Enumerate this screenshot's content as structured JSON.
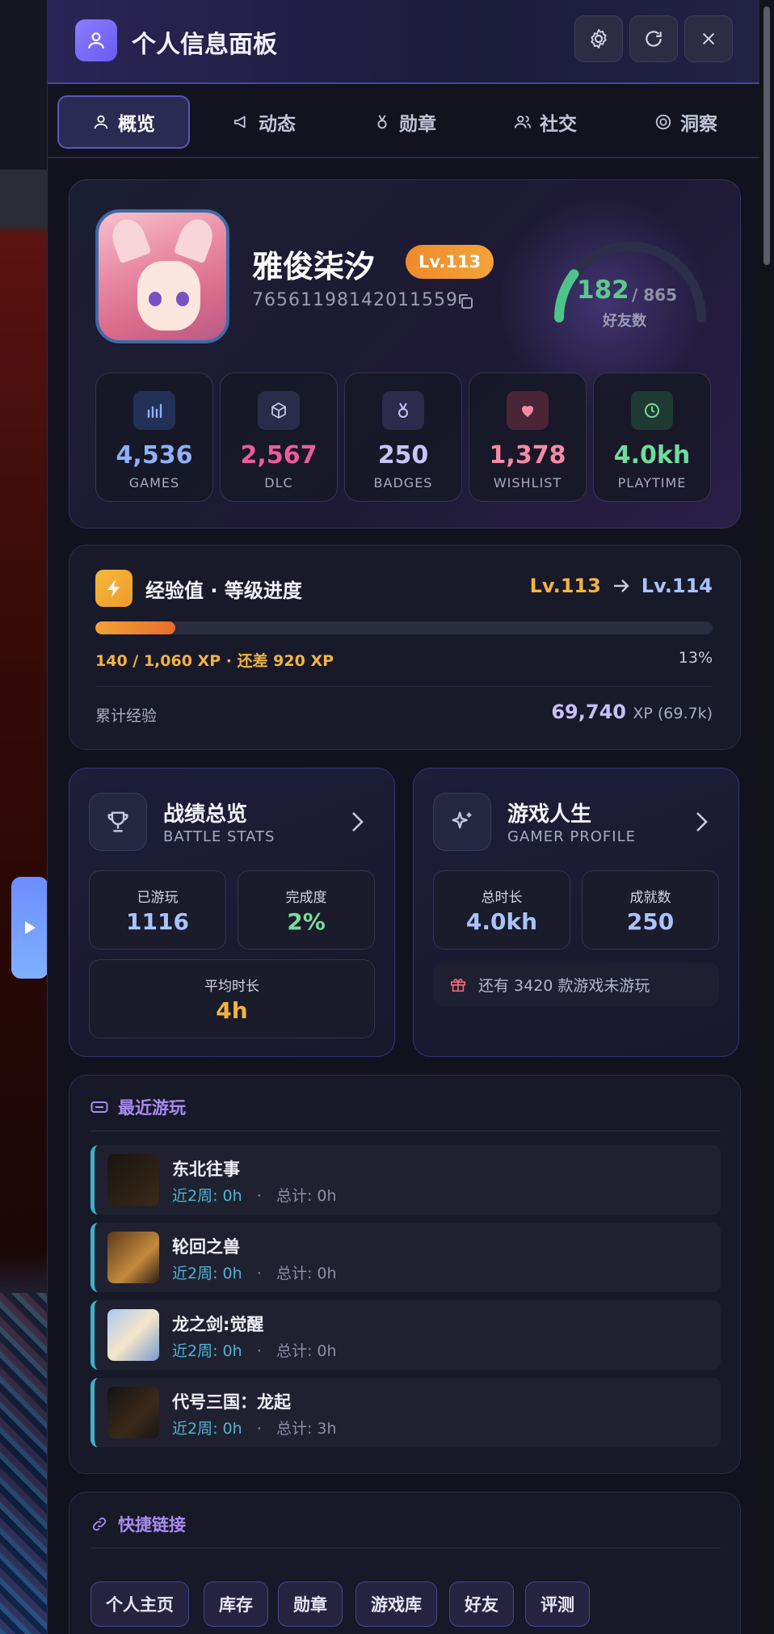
{
  "header": {
    "title": "个人信息面板",
    "icons": [
      "user-icon",
      "gear-icon",
      "refresh-icon",
      "close-icon"
    ]
  },
  "tabs": [
    {
      "label": "概览",
      "icon": "user-icon",
      "active": true
    },
    {
      "label": "动态",
      "icon": "megaphone-icon",
      "active": false
    },
    {
      "label": "勋章",
      "icon": "medal-icon",
      "active": false
    },
    {
      "label": "社交",
      "icon": "people-icon",
      "active": false
    },
    {
      "label": "洞察",
      "icon": "target-icon",
      "active": false
    }
  ],
  "profile": {
    "name": "雅俊柒汐",
    "level": "Lv.113",
    "steam_id": "76561198142011559",
    "friends": {
      "count": "182",
      "total": "/ 865",
      "label": "好友数",
      "fraction": 0.21
    },
    "stats": [
      {
        "value": "4,536",
        "label": "GAMES",
        "icon": "chart-icon",
        "color": "#8fb1f7"
      },
      {
        "value": "2,567",
        "label": "DLC",
        "icon": "box-icon",
        "color": "#ec5c9a"
      },
      {
        "value": "250",
        "label": "BADGES",
        "icon": "medal-icon",
        "color": "#cbc2f7"
      },
      {
        "value": "1,378",
        "label": "WISHLIST",
        "icon": "heart-icon",
        "color": "#f48aa6"
      },
      {
        "value": "4.0kh",
        "label": "PLAYTIME",
        "icon": "clock-icon",
        "color": "#6fdc9c"
      }
    ]
  },
  "xp": {
    "title": "经验值 · 等级进度",
    "from_level": "Lv.113",
    "to_level": "Lv.114",
    "progress_text": "140 / 1,060 XP · 还差 920 XP",
    "percent": "13%",
    "progress": 0.13,
    "total_label": "累计经验",
    "total_value": "69,740",
    "total_suffix": "XP (69.7k)"
  },
  "battle": {
    "title": "战绩总览",
    "subtitle": "BATTLE STATS",
    "items": [
      {
        "label": "已游玩",
        "value": "1116",
        "color": "#a9c4fb"
      },
      {
        "label": "完成度",
        "value": "2%",
        "color": "#79dc9c"
      },
      {
        "label": "平均时长",
        "value": "4h",
        "color": "#f3b341"
      }
    ]
  },
  "gamer": {
    "title": "游戏人生",
    "subtitle": "GAMER PROFILE",
    "items": [
      {
        "label": "总时长",
        "value": "4.0kh",
        "color": "#a9c4fb"
      },
      {
        "label": "成就数",
        "value": "250",
        "color": "#a9c4fb"
      }
    ],
    "notice": "还有 3420 款游戏未游玩"
  },
  "recent": {
    "title": "最近游玩",
    "games": [
      {
        "name": "东北往事",
        "recent": "近2周: 0h",
        "sep": "·",
        "total": "总计: 0h"
      },
      {
        "name": "轮回之兽",
        "recent": "近2周: 0h",
        "sep": "·",
        "total": "总计: 0h"
      },
      {
        "name": "龙之剑:觉醒",
        "recent": "近2周: 0h",
        "sep": "·",
        "total": "总计: 0h"
      },
      {
        "name": "代号三国：龙起",
        "recent": "近2周: 0h",
        "sep": "·",
        "total": "总计: 3h"
      }
    ]
  },
  "links": {
    "title": "快捷链接",
    "items": [
      "个人主页",
      "库存",
      "勋章",
      "游戏库",
      "好友",
      "评测"
    ]
  }
}
